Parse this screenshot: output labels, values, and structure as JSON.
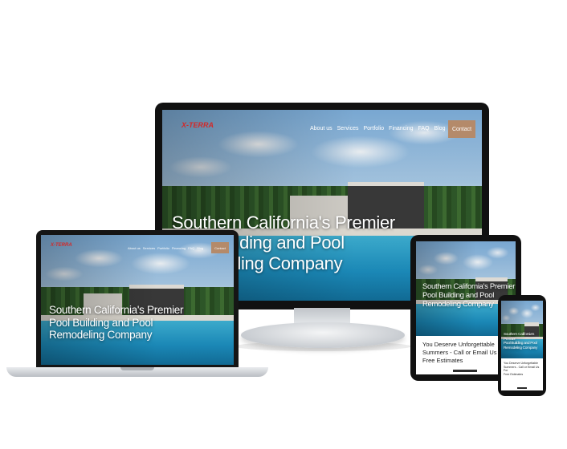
{
  "site": {
    "logo_text": "X-TERRA",
    "nav_items": [
      "About us",
      "Services",
      "Portfolio",
      "Financing",
      "FAQ",
      "Blog"
    ],
    "contact_label": "Contact",
    "social_icons": [
      "facebook-icon",
      "instagram-icon"
    ],
    "headline": "Southern California's Premier Pool Building and Pool Remodeling Company",
    "headline_lines": [
      "Southern California's Premier",
      "Pool Building and Pool",
      "Remodeling Company"
    ],
    "cta": "You Deserve Unforgettable Summers - Call or Email Us For Free Estimates",
    "cta_lines": [
      "You Deserve Unforgettable",
      "Summers - Call or Email Us For",
      "Free Estimates"
    ]
  },
  "colors": {
    "logo": "#d22a2a",
    "contact_button": "#b48a6a",
    "device_frame": "#111111"
  }
}
